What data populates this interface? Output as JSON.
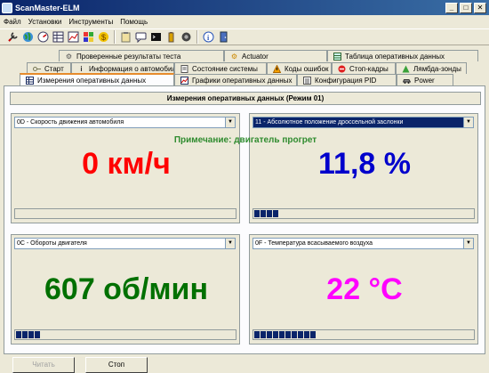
{
  "window": {
    "title": "ScanMaster-ELM",
    "min": "_",
    "max": "□",
    "close": "✕"
  },
  "menu": [
    "Файл",
    "Установки",
    "Инструменты",
    "Помощь"
  ],
  "tabs": {
    "row1": [
      "Проверенные результаты теста",
      "Actuator",
      "Таблица оперативных данных"
    ],
    "row2": [
      "Старт",
      "Информация о автомобиле",
      "Состояние системы",
      "Коды ошибок",
      "Стоп-кадры",
      "Лямбда-зонды"
    ],
    "row3": [
      "Измерения оперативных данных",
      "Графики оперативных данных",
      "Конфигурация PID",
      "Power"
    ]
  },
  "section_title": "Измерения оперативных данных (Режим 01)",
  "note": "Примечание: двигатель прогрет",
  "panels": [
    {
      "select": "0D - Скорость движения автомобиля",
      "value": "0 км/ч",
      "color": "#ff0000",
      "bar_level": 0
    },
    {
      "select": "11 - Абсолютное положение дроссельной заслонки",
      "value": "11,8 %",
      "color": "#0000cc",
      "bar_level": 0.118
    },
    {
      "select": "0C - Обороты двигателя",
      "value": "607 об/мин",
      "color": "#007000",
      "bar_level": 0.1
    },
    {
      "select": "0F - Температура  всасываемого воздуха",
      "value": "22 °C",
      "color": "#ff00ff",
      "bar_level": 0.28
    }
  ],
  "buttons": {
    "read": "Читать",
    "stop": "Стоп"
  },
  "toolbar_icons": [
    "wrench-icon",
    "globe-icon",
    "gauge-icon",
    "table-icon",
    "chart-icon",
    "tiles-icon",
    "dollar-icon",
    "clipboard-icon",
    "comment-icon",
    "terminal-icon",
    "battery-icon",
    "camera-icon",
    "info-icon",
    "door-icon"
  ]
}
